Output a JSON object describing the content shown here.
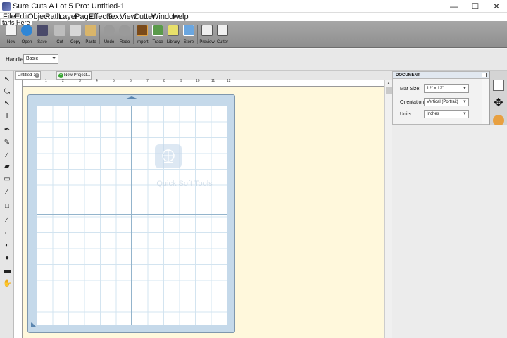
{
  "window": {
    "title": "Sure Cuts A Lot 5 Pro: Untitled-1",
    "min": "—",
    "max": "☐",
    "close": "✕"
  },
  "menu": [
    "File",
    "Edit",
    "Object",
    "Path",
    "Layer",
    "Page",
    "Effects",
    "Text",
    "View",
    "Cutter",
    "Window",
    "Help"
  ],
  "tooltip": "tarts Here",
  "toolbar": [
    {
      "label": "New",
      "icon": "new-icon",
      "color": "#f3f3f3"
    },
    {
      "label": "Open",
      "icon": "open-icon",
      "color": "#2f86d6"
    },
    {
      "label": "Save",
      "icon": "save-icon",
      "color": "#4a4a6a"
    },
    {
      "label": "Cut",
      "icon": "cut-icon",
      "color": "#bdbdbd"
    },
    {
      "label": "Copy",
      "icon": "copy-icon",
      "color": "#d7d7d7"
    },
    {
      "label": "Paste",
      "icon": "paste-icon",
      "color": "#d9b56a"
    },
    {
      "label": "Undo",
      "icon": "undo-icon",
      "color": "#9a9a9a"
    },
    {
      "label": "Redo",
      "icon": "redo-icon",
      "color": "#9a9a9a"
    },
    {
      "label": "Import",
      "icon": "import-icon",
      "color": "#7a4a1a"
    },
    {
      "label": "Trace",
      "icon": "trace-icon",
      "color": "#5a9a4a"
    },
    {
      "label": "Library",
      "icon": "library-icon",
      "color": "#e8e06a"
    },
    {
      "label": "Store",
      "icon": "store-icon",
      "color": "#6aa6e0"
    },
    {
      "label": "Preview",
      "icon": "preview-icon",
      "color": "#eeeeee"
    },
    {
      "label": "Cutter",
      "icon": "cutter-icon",
      "color": "#f0f0f0"
    }
  ],
  "handles": {
    "label": "Handles:",
    "value": "Basic"
  },
  "tabs": {
    "document": "Untitled-1",
    "new_project": "New Project..."
  },
  "ruler": [
    "1",
    "2",
    "3",
    "4",
    "5",
    "6",
    "7",
    "8",
    "9",
    "10",
    "11",
    "12"
  ],
  "tools": [
    "pointer-icon",
    "node-edit-icon",
    "lasso-icon",
    "text-icon",
    "pen-icon",
    "pencil-icon",
    "brush-icon",
    "eraser-icon",
    "fill-icon",
    "eyedropper-icon",
    "rectangle-icon",
    "knife-icon",
    "shape-icon",
    "contrast-icon",
    "zoom-icon",
    "measure-icon",
    "pan-icon"
  ],
  "watermark": "Quick Soft Tools",
  "document_panel": {
    "title": "DOCUMENT",
    "mat_size_label": "Mat Size:",
    "mat_size": "12\" x 12\"",
    "orientation_label": "Orientation:",
    "orientation": "Vertical (Portrait)",
    "units_label": "Units:",
    "units": "Inches"
  },
  "colors": {
    "canvas": "#fff8dc",
    "mat": "#c5d9ea",
    "toolbar": "#9c9c9c"
  }
}
